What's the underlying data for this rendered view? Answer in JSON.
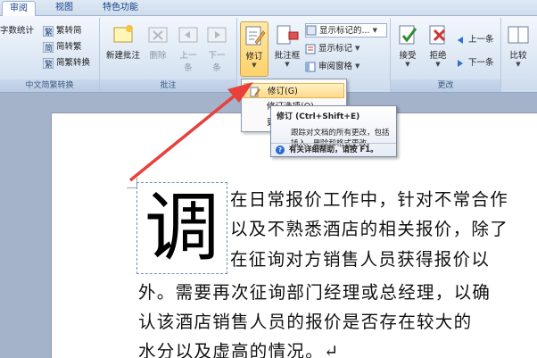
{
  "tabs": [
    "审阅",
    "视图",
    "特色功能"
  ],
  "ribbon": {
    "group_cn_convert": {
      "label": "中文简繁转换",
      "word_count": "字数统计",
      "trad_to_simp": "繁转简",
      "simp_to_trad": "简转繁",
      "convert": "简繁转换"
    },
    "group_comments": {
      "label": "批注",
      "new_comment": "新建批注",
      "delete": "删除",
      "prev": [
        "上一",
        "条"
      ],
      "next": [
        "下一",
        "条"
      ]
    },
    "group_tracking": {
      "track_changes": "修订",
      "balloons": "批注框",
      "show_markup_final": "显示标记的...",
      "show_markup": "显示标记",
      "review_pane": "审阅窗格"
    },
    "group_changes": {
      "label": "更改",
      "accept": "接受",
      "reject": "拒绝",
      "prev": "上一条",
      "next": "下一条"
    },
    "compare": "比较"
  },
  "menu": {
    "items": [
      "修订(G)",
      "修订选项(O)...",
      "更改用户名(U)..."
    ]
  },
  "tooltip": {
    "title": "修订 (Ctrl+Shift+E)",
    "body": "跟踪对文档的所有更改，包括插入、删除和格式更改。",
    "footer": "有关详细帮助，请按 F1。"
  },
  "document": {
    "drop_cap": "调",
    "lines": [
      "在日常报价工作中，针对不常合作",
      "以及不熟悉酒店的相关报价，除了",
      "在征询对方销售人员获得报价以",
      "外。需要再次征询部门经理或总经理，以确",
      "认该酒店销售人员的报价是否存在较大的",
      "水分以及虚高的情况。↵"
    ]
  },
  "colors": {
    "annotation_arrow": "#e8403a",
    "ribbon_text": "#15428b",
    "highlight": "#ffd98a"
  }
}
